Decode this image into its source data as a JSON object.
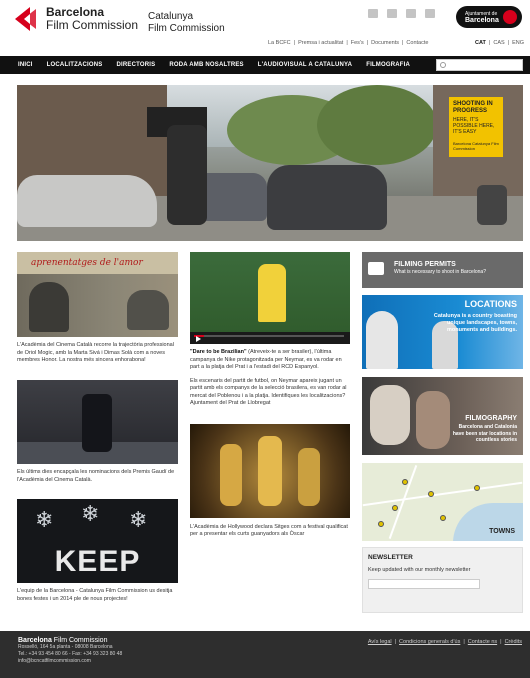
{
  "header": {
    "logo_line1": "Barcelona",
    "logo_line2": "Film Commission",
    "sub_line1": "Catalunya",
    "sub_line2": "Film Commission",
    "badge_line1": "Ajuntament de",
    "badge_line2": "Barcelona",
    "social_icons": [
      "mail-icon",
      "rss-icon",
      "facebook-icon",
      "twitter-icon"
    ],
    "top_links": [
      "La BCFC",
      "|",
      "Premsa i actualitat",
      "|",
      "Fes's",
      "|",
      "Documents",
      "|",
      "Contacte"
    ],
    "languages": [
      "CAT",
      "|",
      "CAS",
      "|",
      "ENG"
    ]
  },
  "nav": {
    "items": [
      "INICI",
      "LOCALITZACIONS",
      "DIRECTORIS",
      "RODA AMB NOSALTRES",
      "L'AUDIOVISUAL A CATALUNYA",
      "FILMOGRAFIA"
    ],
    "search_placeholder": ""
  },
  "hero": {
    "badge_title": "SHOOTING IN PROGRESS",
    "badge_text": "HERE, IT'S POSSIBLE HERE, IT'S EASY",
    "badge_footer": "Barcelona Catalunya Film Commission"
  },
  "col1": {
    "item1_thumb_text": "aprenentatges de l'amor",
    "item1_caption": "L'Acadèmia del Cinema Català recorre la trajectòria professional de Oriol Mogic, amb la Marta Sivá i Dimas Solà com a noves membres Honor. La nostra més sincera enhorabona!",
    "item2_caption": "Els últims dies encapçala les nominacions dels Premis Gaudí de l'Acadèmia del Cinema Català.",
    "item3_thumb_text": "KEEP",
    "item3_caption": "L'equip de la Barcelona - Catalunya Film Commission us desitja bones festes i un 2014 ple de nous projectes!"
  },
  "col2": {
    "item1_caption_bold": "\"Dare to be Brazilian\"",
    "item1_caption": " (Atreveix-te a ser brasiler), l'última campanya de Nike protagonitzada per Neymar, es va rodar en part a la platja del Prat i a l'estadi del RCD Espanyol.",
    "item1_caption2": "Els escenaris del partit de futbol, on Neymar apareix jugant un partit amb els companys de la selecció brasilera, es van rodar al mercat del Poblenou i a la platja. Identifiques les localitzacions? Ajuntament del Prat de Llobregat",
    "item2_caption": "L'Acadèmia de Hollywood declara Sitges com a festival qualificat per a presentar els curts guanyadors als Òscar"
  },
  "col3": {
    "permits_title": "FILMING PERMITS",
    "permits_sub": "What is necessary to shoot in Barcelona?",
    "locations_title": "LOCATIONS",
    "locations_text": "Catalunya is a country boasting unique landscapes, towns, monuments and buildings.",
    "filmography_title": "FILMOGRAPHY",
    "filmography_text": "Barcelona and Catalonia have been star locations in countless stories",
    "towns_title": "TOWNS",
    "newsletter_title": "NEWSLETTER",
    "newsletter_text": "Keep updated with our monthly newsletter",
    "newsletter_placeholder": ""
  },
  "footer": {
    "brand_bold": "Barcelona",
    "brand_rest": " Film Commission",
    "address1": "Rosselló, 164 5a planta - 08008 Barcelona",
    "address2": "Tel.: +34 93 454 80 66 - Fax: +34 93 323 80 48",
    "email": "info@bcncatfilmcommission.com",
    "links": [
      "Avís legal",
      "|",
      "Condicions generals d'ús",
      "|",
      "Contacte ns",
      "|",
      "Crèdits"
    ]
  },
  "colors": {
    "brand_red": "#d6001c",
    "nav_bg": "#111111",
    "footer_bg": "#2e2e2e",
    "shooting_yellow": "#f2c200",
    "locations_blue": "#1a8bd3"
  }
}
